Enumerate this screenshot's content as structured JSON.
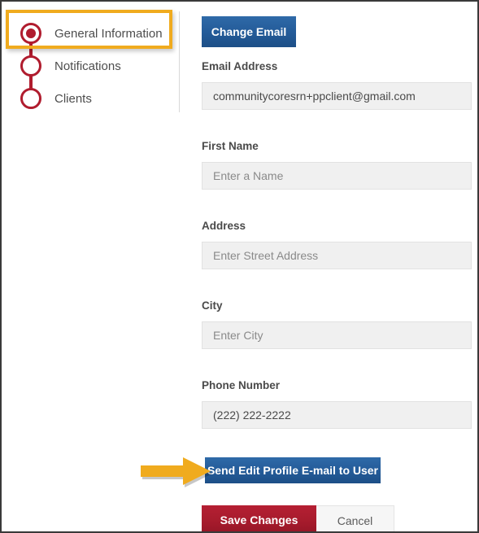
{
  "colors": {
    "accent_red": "#b01c2e",
    "accent_blue": "#255d9b",
    "highlight_yellow": "#f0ab1e",
    "field_gray": "#f0f0f0",
    "border_dark": "#3a3a3a"
  },
  "sidebar": {
    "steps": [
      {
        "label": "General Information",
        "state": "active",
        "dot": "filled-circle-icon"
      },
      {
        "label": "Notifications",
        "state": "inactive",
        "dot": "empty-circle-icon"
      },
      {
        "label": "Clients",
        "state": "inactive",
        "dot": "empty-circle-icon"
      }
    ]
  },
  "form": {
    "change_email_label": "Change Email",
    "fields": [
      {
        "label": "Email Address",
        "value": "communitycoresrn+ppclient@gmail.com",
        "placeholder": "",
        "filled": true
      },
      {
        "label": "First Name",
        "value": "",
        "placeholder": "Enter a Name",
        "filled": false
      },
      {
        "label": "Address",
        "value": "",
        "placeholder": "Enter Street Address",
        "filled": false
      },
      {
        "label": "City",
        "value": "",
        "placeholder": "Enter City",
        "filled": false
      },
      {
        "label": "Phone Number",
        "value": "(222) 222-2222",
        "placeholder": "",
        "filled": true
      }
    ],
    "send_email_label": "Send Edit Profile E-mail to User",
    "save_label": "Save Changes",
    "cancel_label": "Cancel"
  },
  "annotations": {
    "arrow": "right-arrow-annotation",
    "highlight": "rectangle-highlight-annotation"
  }
}
